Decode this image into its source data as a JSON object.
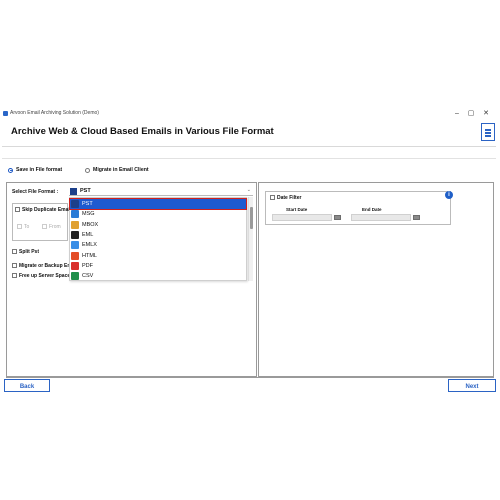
{
  "window": {
    "title": "Arvoon Email Archiving Solution (Demo)",
    "controls": {
      "minimize": "–",
      "maximize": "▢",
      "close": "✕"
    }
  },
  "header": {
    "title": "Archive Web & Cloud Based Emails in Various File Format",
    "menu_icon": "hamburger-menu-icon"
  },
  "mode": {
    "options": [
      {
        "label": "Save in File format",
        "selected": true
      },
      {
        "label": "Migrate in Email Client",
        "selected": false
      }
    ]
  },
  "left_panel": {
    "format_label": "Select File Format :",
    "selected_format": "PST",
    "skip_duplicate_label": "Skip Duplicate Email",
    "to_label": "To",
    "from_label": "From",
    "split_pst_label": "Split Pst",
    "migrate_backup_label": "Migrate or Backup Em",
    "free_up_label": "Free up Server Space",
    "formats": [
      {
        "label": "PST",
        "color": "#1c3f8a",
        "icon": "outlook-pst-icon"
      },
      {
        "label": "MSG",
        "color": "#2a7bd6",
        "icon": "msg-icon"
      },
      {
        "label": "MBOX",
        "color": "#e0a030",
        "icon": "mbox-icon"
      },
      {
        "label": "EML",
        "color": "#222222",
        "icon": "eml-icon"
      },
      {
        "label": "EMLX",
        "color": "#3a8ee6",
        "icon": "emlx-icon"
      },
      {
        "label": "HTML",
        "color": "#e44d26",
        "icon": "html-icon"
      },
      {
        "label": "PDF",
        "color": "#d9302c",
        "icon": "pdf-icon"
      },
      {
        "label": "CSV",
        "color": "#1f8f4a",
        "icon": "csv-icon"
      }
    ]
  },
  "right_panel": {
    "date_filter_label": "Date Filter",
    "start_date_label": "Start Date",
    "end_date_label": "End Date",
    "info_glyph": "i"
  },
  "footer": {
    "back_label": "Back",
    "next_label": "Next"
  }
}
